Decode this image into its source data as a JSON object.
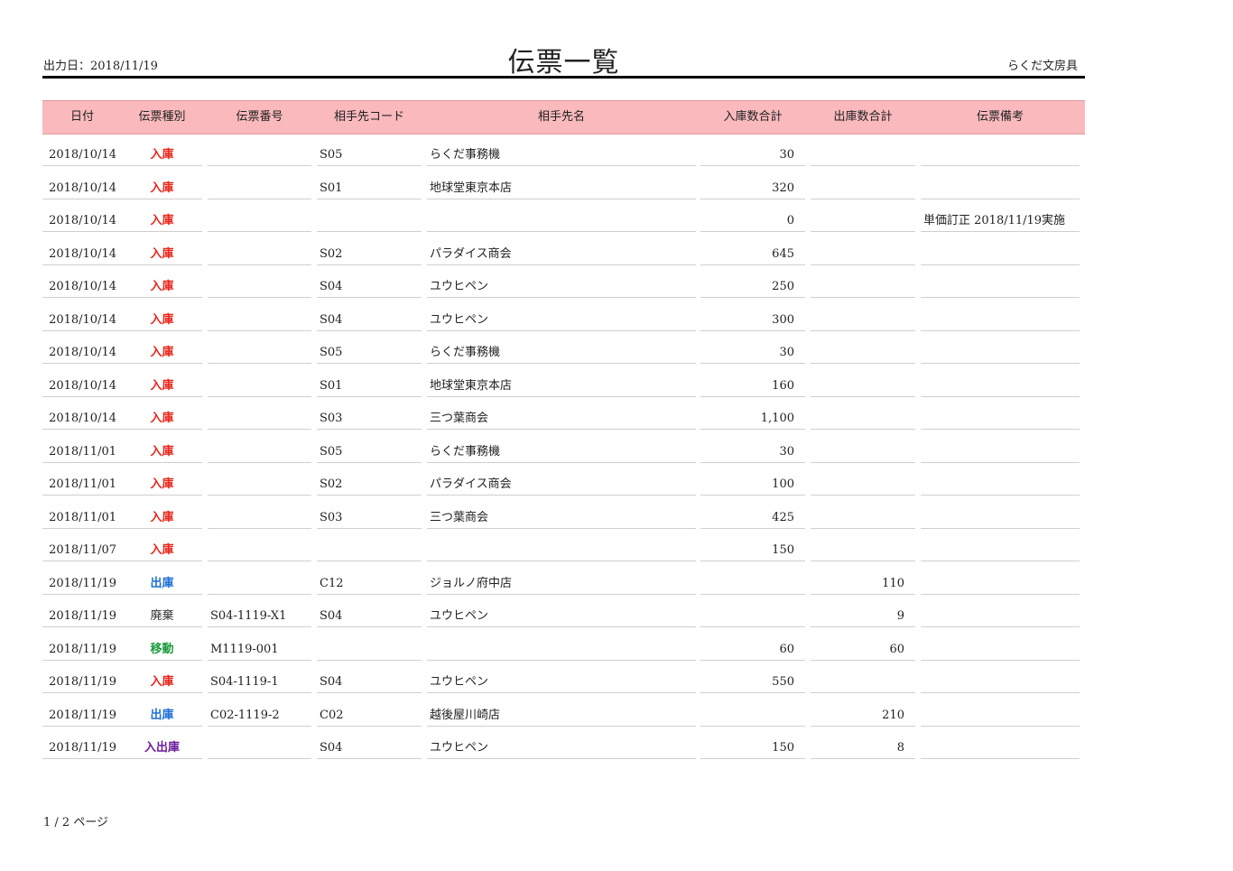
{
  "header": {
    "output_date": "出力日：2018/11/19",
    "title": "伝票一覧",
    "company": "らくだ文房具"
  },
  "columns": [
    "日付",
    "伝票種別",
    "伝票番号",
    "相手先コード",
    "相手先名",
    "入庫数合計",
    "出庫数合計",
    "伝票備考"
  ],
  "type_colors": {
    "入庫": "#e8261b",
    "出庫": "#1f6fd6",
    "廃棄": "#333333",
    "移動": "#1a9a3a",
    "入出庫": "#6a1d9a"
  },
  "rows": [
    {
      "date": "2018/10/14",
      "type": "入庫",
      "number": "",
      "code": "S05",
      "name": "らくだ事務機",
      "in_total": "30",
      "out_total": "",
      "memo": ""
    },
    {
      "date": "2018/10/14",
      "type": "入庫",
      "number": "",
      "code": "S01",
      "name": "地球堂東京本店",
      "in_total": "320",
      "out_total": "",
      "memo": ""
    },
    {
      "date": "2018/10/14",
      "type": "入庫",
      "number": "",
      "code": "",
      "name": "",
      "in_total": "0",
      "out_total": "",
      "memo": "単価訂正 2018/11/19実施"
    },
    {
      "date": "2018/10/14",
      "type": "入庫",
      "number": "",
      "code": "S02",
      "name": "パラダイス商会",
      "in_total": "645",
      "out_total": "",
      "memo": ""
    },
    {
      "date": "2018/10/14",
      "type": "入庫",
      "number": "",
      "code": "S04",
      "name": "ユウヒペン",
      "in_total": "250",
      "out_total": "",
      "memo": ""
    },
    {
      "date": "2018/10/14",
      "type": "入庫",
      "number": "",
      "code": "S04",
      "name": "ユウヒペン",
      "in_total": "300",
      "out_total": "",
      "memo": ""
    },
    {
      "date": "2018/10/14",
      "type": "入庫",
      "number": "",
      "code": "S05",
      "name": "らくだ事務機",
      "in_total": "30",
      "out_total": "",
      "memo": ""
    },
    {
      "date": "2018/10/14",
      "type": "入庫",
      "number": "",
      "code": "S01",
      "name": "地球堂東京本店",
      "in_total": "160",
      "out_total": "",
      "memo": ""
    },
    {
      "date": "2018/10/14",
      "type": "入庫",
      "number": "",
      "code": "S03",
      "name": "三つ葉商会",
      "in_total": "1,100",
      "out_total": "",
      "memo": ""
    },
    {
      "date": "2018/11/01",
      "type": "入庫",
      "number": "",
      "code": "S05",
      "name": "らくだ事務機",
      "in_total": "30",
      "out_total": "",
      "memo": ""
    },
    {
      "date": "2018/11/01",
      "type": "入庫",
      "number": "",
      "code": "S02",
      "name": "パラダイス商会",
      "in_total": "100",
      "out_total": "",
      "memo": ""
    },
    {
      "date": "2018/11/01",
      "type": "入庫",
      "number": "",
      "code": "S03",
      "name": "三つ葉商会",
      "in_total": "425",
      "out_total": "",
      "memo": ""
    },
    {
      "date": "2018/11/07",
      "type": "入庫",
      "number": "",
      "code": "",
      "name": "",
      "in_total": "150",
      "out_total": "",
      "memo": ""
    },
    {
      "date": "2018/11/19",
      "type": "出庫",
      "number": "",
      "code": "C12",
      "name": "ジョルノ府中店",
      "in_total": "",
      "out_total": "110",
      "memo": ""
    },
    {
      "date": "2018/11/19",
      "type": "廃棄",
      "number": "S04-1119-X1",
      "code": "S04",
      "name": "ユウヒペン",
      "in_total": "",
      "out_total": "9",
      "memo": ""
    },
    {
      "date": "2018/11/19",
      "type": "移動",
      "number": "M1119-001",
      "code": "",
      "name": "",
      "in_total": "60",
      "out_total": "60",
      "memo": ""
    },
    {
      "date": "2018/11/19",
      "type": "入庫",
      "number": "S04-1119-1",
      "code": "S04",
      "name": "ユウヒペン",
      "in_total": "550",
      "out_total": "",
      "memo": ""
    },
    {
      "date": "2018/11/19",
      "type": "出庫",
      "number": "C02-1119-2",
      "code": "C02",
      "name": "越後屋川崎店",
      "in_total": "",
      "out_total": "210",
      "memo": ""
    },
    {
      "date": "2018/11/19",
      "type": "入出庫",
      "number": "",
      "code": "S04",
      "name": "ユウヒペン",
      "in_total": "150",
      "out_total": "8",
      "memo": ""
    }
  ],
  "footer": {
    "page_info": "1 / 2 ページ"
  }
}
